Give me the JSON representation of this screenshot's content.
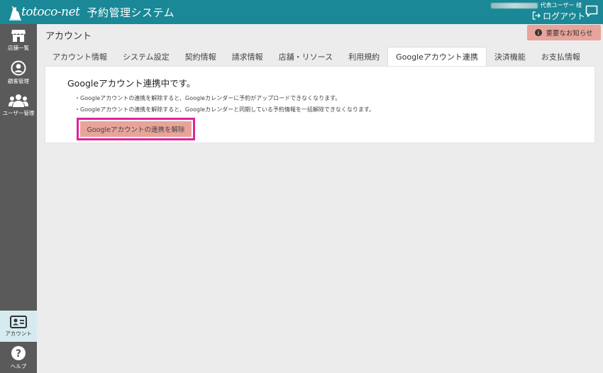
{
  "header": {
    "logo_text": "totoco-net",
    "app_title": "予約管理システム",
    "user_role": "代表ユーザー 様",
    "logout_label": "ログアウト"
  },
  "sidebar": {
    "items": [
      {
        "label": "店舗一覧",
        "icon": "store-icon"
      },
      {
        "label": "顧客管理",
        "icon": "person-circle-icon"
      },
      {
        "label": "ユーザー管理",
        "icon": "users-icon"
      },
      {
        "label": "アカウント",
        "icon": "id-card-icon",
        "active": true
      },
      {
        "label": "ヘルプ",
        "icon": "help-icon"
      }
    ]
  },
  "main": {
    "page_title": "アカウント",
    "notice_label": "重要なお知らせ",
    "tabs": [
      {
        "label": "アカウント情報"
      },
      {
        "label": "システム設定"
      },
      {
        "label": "契約情報"
      },
      {
        "label": "請求情報"
      },
      {
        "label": "店舗・リソース"
      },
      {
        "label": "利用規約"
      },
      {
        "label": "Googleアカウント連携",
        "active": true
      },
      {
        "label": "決済機能"
      },
      {
        "label": "お支払情報"
      }
    ],
    "panel": {
      "title": "Googleアカウント連携中です。",
      "notes": [
        "・Googleアカウントの連携を解除すると、Googleカレンダーに予約がアップロードできなくなります。",
        "・Googleアカウントの連携を解除すると、Googleカレンダーと同期している予約情報を一括解除できなくなります。"
      ],
      "unlink_button": "Googleアカウントの連携を解除"
    }
  },
  "colors": {
    "header": "#1a8896",
    "sidebar": "#5a5a5a",
    "accent_button": "#e8a49b",
    "highlight_border": "#e0239a"
  }
}
